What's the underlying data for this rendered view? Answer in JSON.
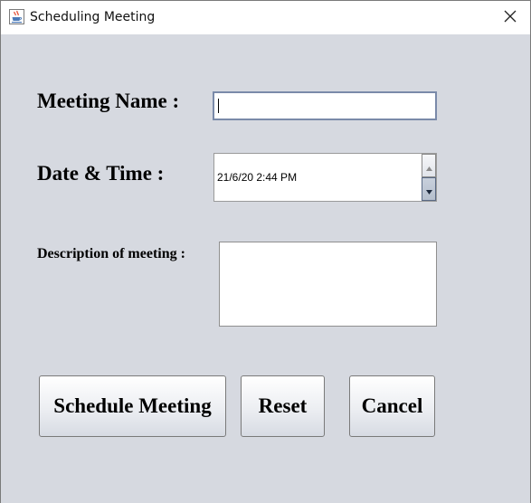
{
  "window": {
    "title": "Scheduling Meeting"
  },
  "form": {
    "meeting_name_label": "Meeting Name :",
    "meeting_name_value": "",
    "date_time_label": "Date & Time  :",
    "date_time_value": "21/6/20 2:44 PM",
    "description_label": "Description of meeting :",
    "description_value": ""
  },
  "buttons": {
    "schedule": "Schedule Meeting",
    "reset": "Reset",
    "cancel": "Cancel"
  },
  "icons": {
    "app": "java-cup-icon",
    "close": "close-icon",
    "spin_up": "triangle-up-icon",
    "spin_down": "triangle-down-icon"
  }
}
